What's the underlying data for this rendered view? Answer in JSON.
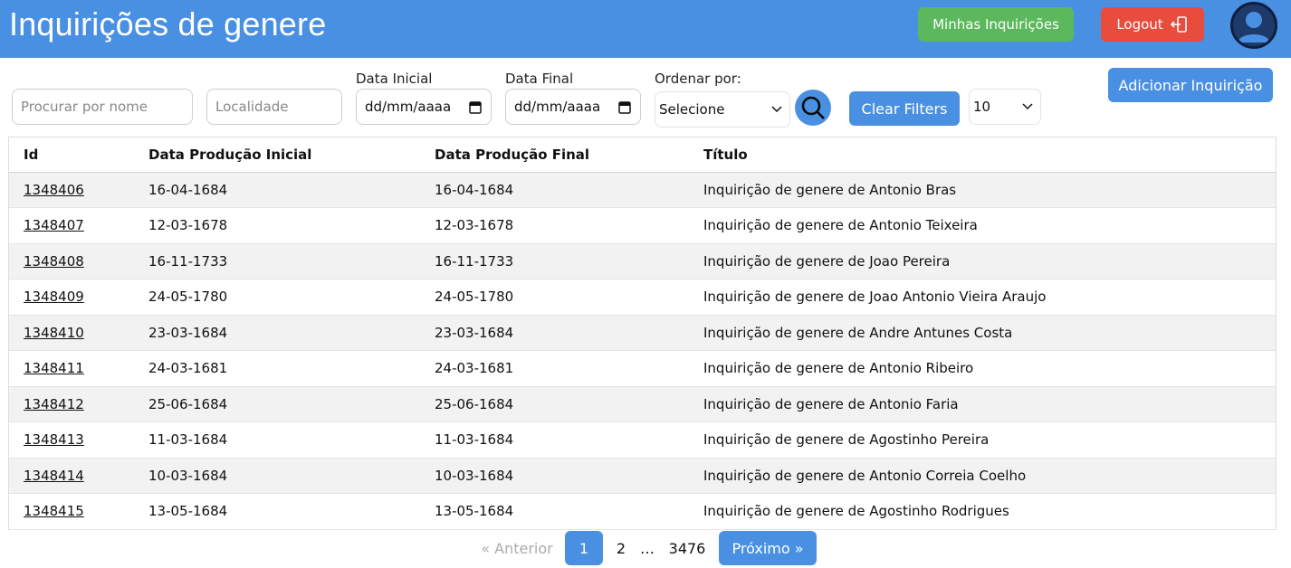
{
  "header": {
    "title": "Inquirições de genere",
    "minhas_label": "Minhas Inquirições",
    "logout_label": "Logout"
  },
  "filters": {
    "name_placeholder": "Procurar por nome",
    "locality_placeholder": "Localidade",
    "date_initial_label": "Data Inicial",
    "date_initial_value": "dd/mm/aaaa",
    "date_final_label": "Data Final",
    "date_final_value": "dd/mm/aaaa",
    "order_label": "Ordenar por:",
    "order_value": "Selecione",
    "clear_label": "Clear Filters",
    "page_size_value": "10",
    "add_label": "Adicionar Inquirição"
  },
  "table": {
    "headers": [
      "Id",
      "Data Produção Inicial",
      "Data Produção Final",
      "Título"
    ],
    "rows": [
      [
        "1348406",
        "16-04-1684",
        "16-04-1684",
        "Inquirição de genere de Antonio Bras"
      ],
      [
        "1348407",
        "12-03-1678",
        "12-03-1678",
        "Inquirição de genere de Antonio Teixeira"
      ],
      [
        "1348408",
        "16-11-1733",
        "16-11-1733",
        "Inquirição de genere de Joao Pereira"
      ],
      [
        "1348409",
        "24-05-1780",
        "24-05-1780",
        "Inquirição de genere de Joao Antonio Vieira Araujo"
      ],
      [
        "1348410",
        "23-03-1684",
        "23-03-1684",
        "Inquirição de genere de Andre Antunes Costa"
      ],
      [
        "1348411",
        "24-03-1681",
        "24-03-1681",
        "Inquirição de genere de Antonio Ribeiro"
      ],
      [
        "1348412",
        "25-06-1684",
        "25-06-1684",
        "Inquirição de genere de Antonio Faria"
      ],
      [
        "1348413",
        "11-03-1684",
        "11-03-1684",
        "Inquirição de genere de Agostinho Pereira"
      ],
      [
        "1348414",
        "10-03-1684",
        "10-03-1684",
        "Inquirição de genere de Antonio Correia Coelho"
      ],
      [
        "1348415",
        "13-05-1684",
        "13-05-1684",
        "Inquirição de genere de Agostinho Rodrigues"
      ]
    ]
  },
  "pagination": {
    "prev_label": "« Anterior",
    "current_page": "1",
    "page_2": "2",
    "ellipsis": "…",
    "last_page": "3476",
    "next_label": "Próximo »"
  },
  "colors": {
    "primary": "#4a90e2",
    "success": "#5cb85c",
    "danger": "#e74c3c",
    "avatar": "#1d3a6b"
  },
  "icons": {
    "logout": "logout-door-icon",
    "avatar": "user-avatar-icon",
    "search": "search-icon",
    "calendar": "calendar-icon",
    "chevron": "chevron-down-icon"
  }
}
